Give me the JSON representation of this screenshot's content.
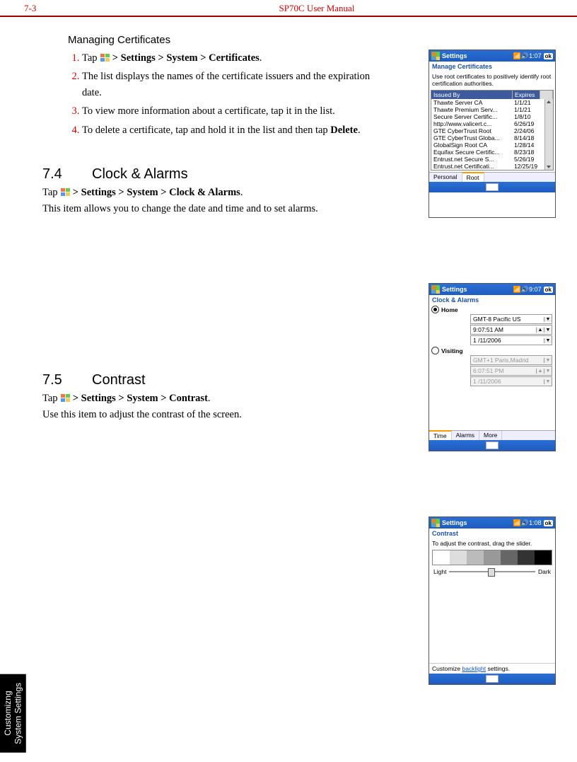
{
  "header": {
    "page_ref": "7-3",
    "title": "SP70C User Manual"
  },
  "section_certs": {
    "heading": "Managing Certificates",
    "step1_a": "Tap ",
    "step1_b": " > Settings > System > Certificates",
    "step1_c": ".",
    "step2": "The list displays the names of the certificate issuers and the expiration date.",
    "step3": "To view more information about a certificate, tap it in the list.",
    "step4_a": "To delete a certificate, tap and hold it in the list and then tap ",
    "step4_b": "Delete",
    "step4_c": "."
  },
  "section_clock": {
    "num": "7.4",
    "title": "Clock & Alarms",
    "p1_a": "Tap ",
    "p1_b": " > Settings > System > Clock & Alarms",
    "p1_c": ".",
    "p2": "This item allows you to change the date and time and to set alarms."
  },
  "section_contrast": {
    "num": "7.5",
    "title": "Contrast",
    "p1_a": "Tap ",
    "p1_b": " > Settings > System > Contrast",
    "p1_c": ".",
    "p2": "Use this item to adjust the contrast of the screen."
  },
  "device_certs": {
    "bar_title": "Settings",
    "time": "1:07",
    "ok": "ok",
    "subtitle": "Manage Certificates",
    "blurb": "Use root certificates to positively identify root certification authorities.",
    "col_issued": "Issued By",
    "col_expires": "Expires",
    "rows": [
      {
        "name": "Thawte Server CA",
        "exp": "1/1/21"
      },
      {
        "name": "Thawte Premium Serv...",
        "exp": "1/1/21"
      },
      {
        "name": "Secure Server Certific...",
        "exp": "1/8/10"
      },
      {
        "name": "http://www.valicert.c...",
        "exp": "6/26/19"
      },
      {
        "name": "GTE CyberTrust Root",
        "exp": "2/24/06"
      },
      {
        "name": "GTE CyberTrust Globa...",
        "exp": "8/14/18"
      },
      {
        "name": "GlobalSign Root CA",
        "exp": "1/28/14"
      },
      {
        "name": "Equifax Secure Certific...",
        "exp": "8/23/18"
      },
      {
        "name": "Entrust.net Secure S...",
        "exp": "5/26/19"
      },
      {
        "name": "Entrust.net Certificati...",
        "exp": "12/25/19"
      }
    ],
    "tab_personal": "Personal",
    "tab_root": "Root"
  },
  "device_clock": {
    "bar_title": "Settings",
    "time": "9:07",
    "ok": "ok",
    "subtitle": "Clock & Alarms",
    "home_label": "Home",
    "home_tz": "GMT-8 Pacific US",
    "home_time": "9:07:51 AM",
    "home_date": "1 /11/2006",
    "visit_label": "Visiting",
    "visit_tz": "GMT+1 Paris,Madrid",
    "visit_time": "6:07:51 PM",
    "visit_date": "1 /11/2006",
    "tab_time": "Time",
    "tab_alarms": "Alarms",
    "tab_more": "More"
  },
  "device_contrast": {
    "bar_title": "Settings",
    "time": "1:08",
    "ok": "ok",
    "subtitle": "Contrast",
    "blurb": "To adjust the contrast, drag the slider.",
    "light": "Light",
    "dark": "Dark",
    "foot_a": "Customize ",
    "foot_link": "backlight",
    "foot_b": " settings."
  },
  "sidetab": "Customizng\nSystem Settings"
}
